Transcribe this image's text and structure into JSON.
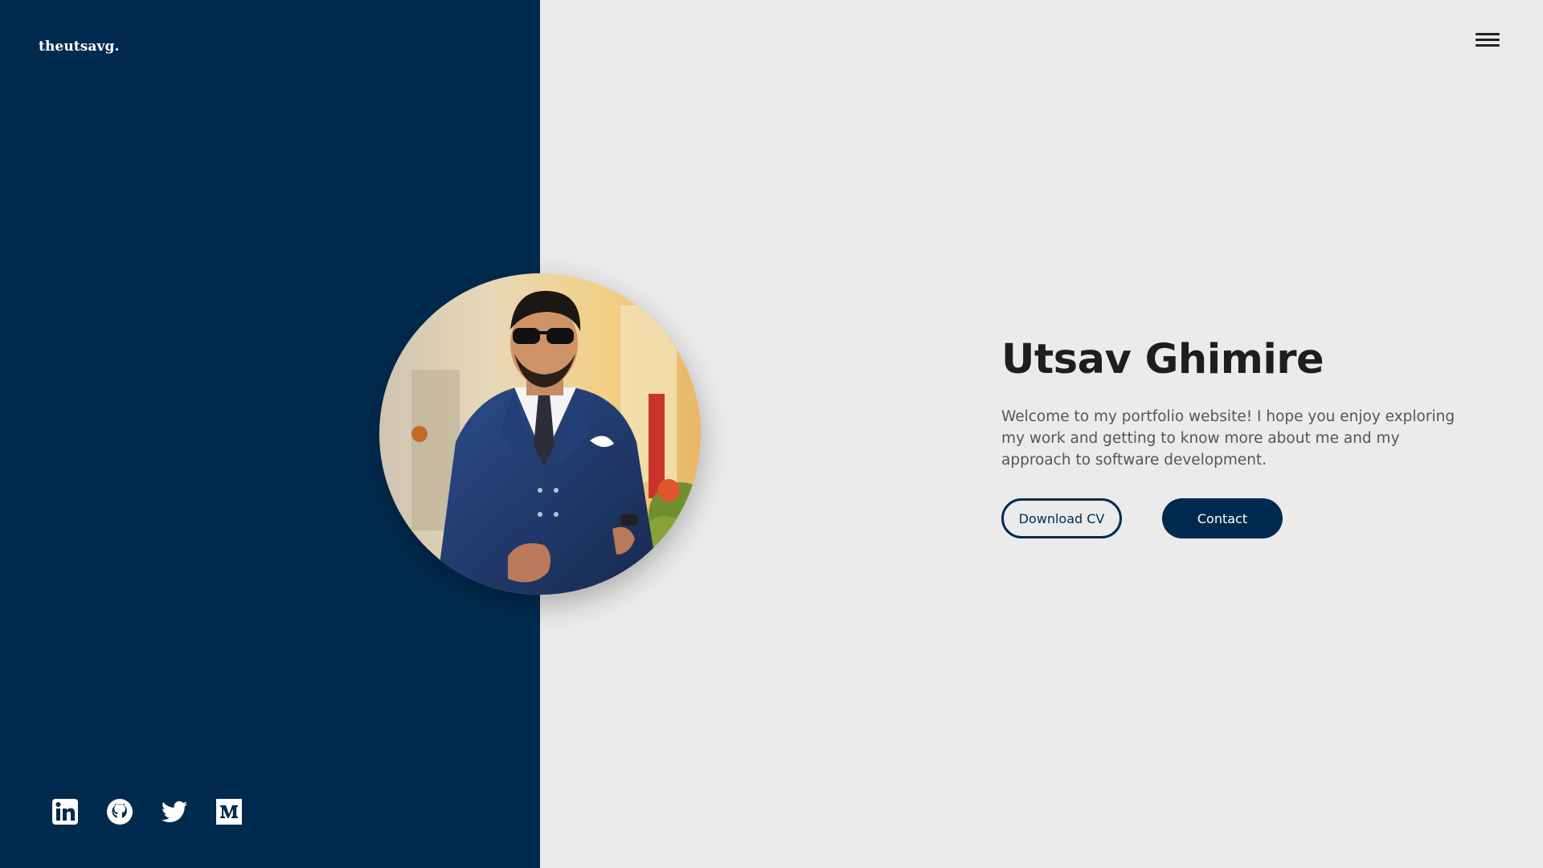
{
  "brand": {
    "logo_text": "theutsavg."
  },
  "nav": {
    "menu_icon": "hamburger-menu-icon"
  },
  "hero": {
    "name": "Utsav Ghimire",
    "intro": "Welcome to my portfolio website! I hope you enjoy exploring my work and getting to know more about me and my approach to software development.",
    "buttons": {
      "download_cv": "Download CV",
      "contact": "Contact"
    }
  },
  "social": [
    {
      "icon": "linkedin-icon"
    },
    {
      "icon": "github-icon"
    },
    {
      "icon": "twitter-icon"
    },
    {
      "icon": "medium-icon"
    }
  ],
  "colors": {
    "left_panel": "#002b4f",
    "background": "#ebebeb",
    "heading": "#1e1e1e",
    "body_text": "#555555",
    "accent": "#002b4f"
  }
}
